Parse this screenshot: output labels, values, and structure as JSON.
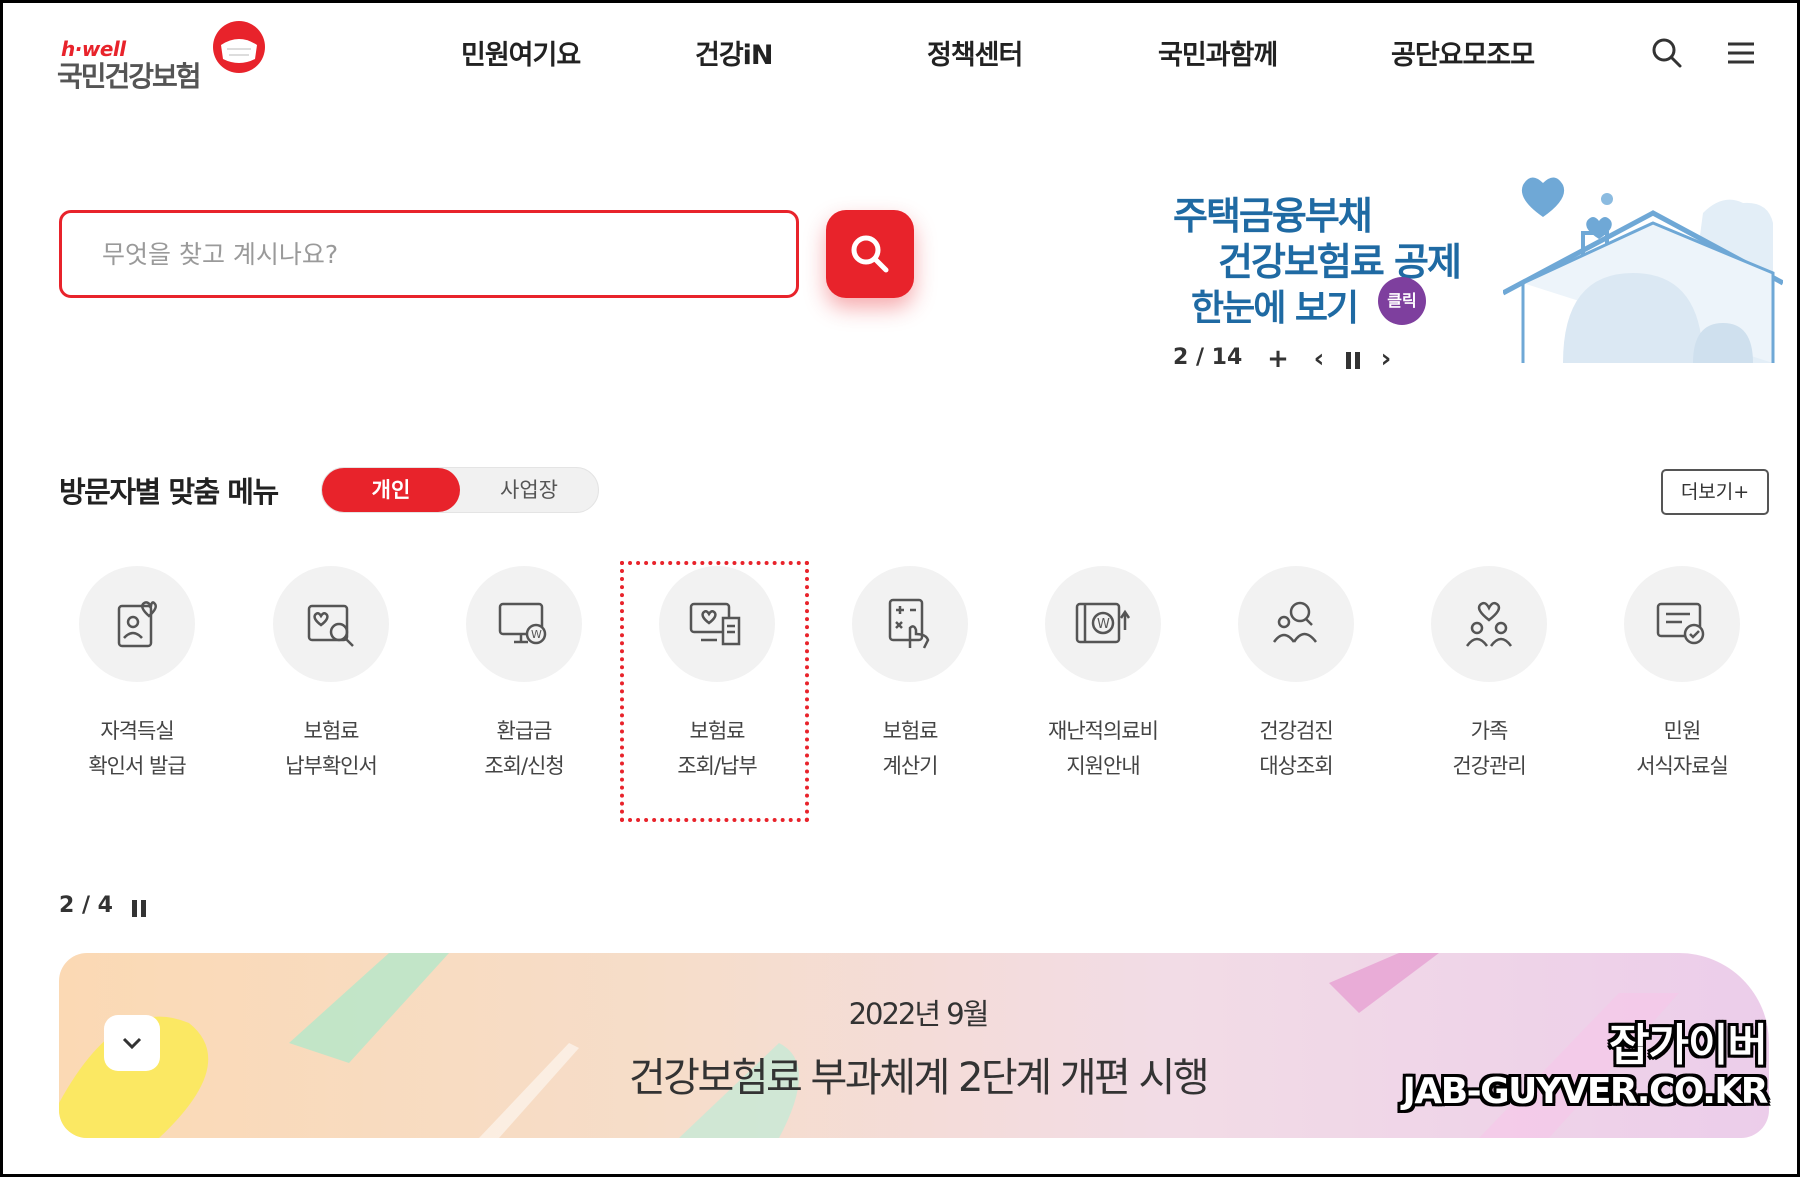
{
  "logo": {
    "sub": "h·well",
    "main": "국민건강보험"
  },
  "nav": {
    "items": [
      "민원여기요",
      "건강iN",
      "정책센터",
      "국민과함께",
      "공단요모조모"
    ]
  },
  "header_icons": [
    "search-icon",
    "hamburger-menu-icon"
  ],
  "search": {
    "placeholder": "무엇을 찾고 계시나요?",
    "value": ""
  },
  "banner": {
    "line1": "주택금융부채",
    "line2": "건강보험료 공제",
    "line3": "한눈에 보기",
    "badge": "클릭",
    "pager": "2 / 14",
    "add": "+",
    "prev": "‹",
    "next": "›"
  },
  "custom_menu": {
    "title": "방문자별 맞춤 메뉴",
    "toggle": {
      "active": "개인",
      "inactive": "사업장"
    },
    "more": "더보기+",
    "items": [
      {
        "line1": "자격득실",
        "line2": "확인서 발급",
        "icon": "certificate-person-icon"
      },
      {
        "line1": "보험료",
        "line2": "납부확인서",
        "icon": "payment-search-icon"
      },
      {
        "line1": "환급금",
        "line2": "조회/신청",
        "icon": "monitor-won-icon"
      },
      {
        "line1": "보험료",
        "line2": "조회/납부",
        "icon": "monitor-receipt-icon"
      },
      {
        "line1": "보험료",
        "line2": "계산기",
        "icon": "calculator-hand-icon"
      },
      {
        "line1": "재난적의료비",
        "line2": "지원안내",
        "icon": "wallet-won-icon"
      },
      {
        "line1": "건강검진",
        "line2": "대상조회",
        "icon": "people-search-icon"
      },
      {
        "line1": "가족",
        "line2": "건강관리",
        "icon": "family-heart-icon"
      },
      {
        "line1": "민원",
        "line2": "서식자료실",
        "icon": "document-check-icon"
      }
    ]
  },
  "notice": {
    "pager": "2 / 4",
    "date": "2022년 9월",
    "title": "건강보험료 부과체계 2단계 개편 시행"
  },
  "watermark": {
    "line1": "잡가이버",
    "line2": "JAB-GUYVER.CO.KR"
  },
  "colors": {
    "brand_red": "#e8232b",
    "banner_blue": "#1f6aa3",
    "badge_purple": "#7e3f9e"
  }
}
